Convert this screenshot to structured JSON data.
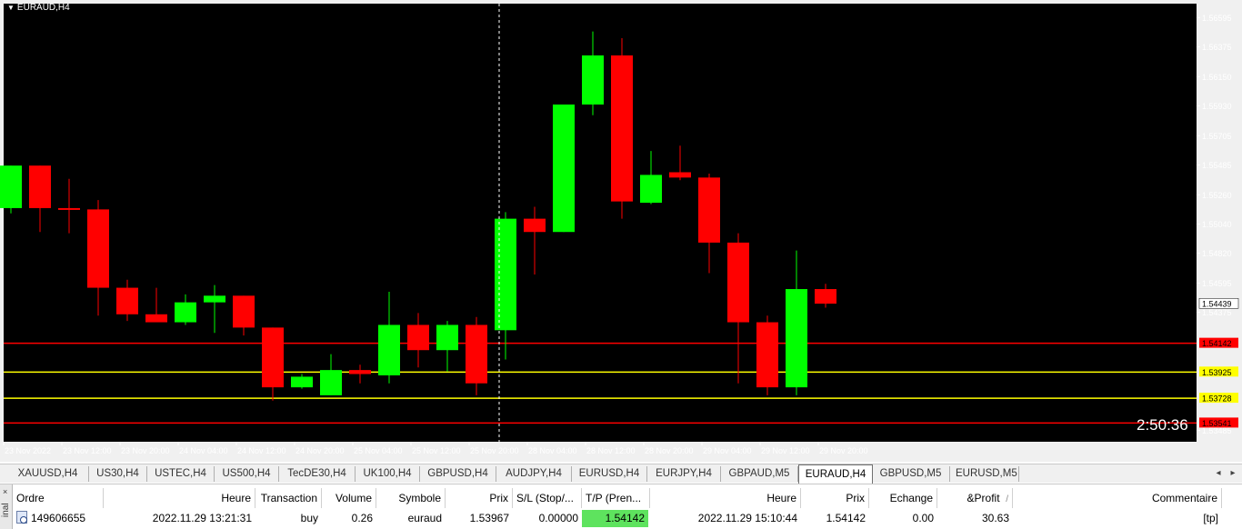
{
  "chart": {
    "title": "EURAUD,H4",
    "countdown": "2:50:36",
    "colors": {
      "bg": "#000000",
      "bull": "#00ff00",
      "bear": "#ff0000",
      "axis_text": "#ffffff",
      "crosshair": "#ffffff",
      "grid_bg": "#f0f0f0"
    },
    "price_labels": [
      "1.56595",
      "1.56375",
      "1.56150",
      "1.55930",
      "1.55705",
      "1.55485",
      "1.55260",
      "1.55040",
      "1.54820",
      "1.54595",
      "1.54375",
      "1.53485"
    ],
    "time_labels": [
      "23 Nov 2022",
      "23 Nov 12:00",
      "23 Nov 20:00",
      "24 Nov 04:00",
      "24 Nov 12:00",
      "24 Nov 20:00",
      "25 Nov 04:00",
      "25 Nov 12:00",
      "25 Nov 20:00",
      "28 Nov 04:00",
      "28 Nov 12:00",
      "28 Nov 20:00",
      "29 Nov 04:00",
      "29 Nov 12:00",
      "29 Nov 20:00"
    ],
    "current_price": {
      "label": "1.54439",
      "value": 1.54439
    },
    "levels": [
      {
        "label": "1.54142",
        "value": 1.54142,
        "color": "#ff0000",
        "text_color": "#000000"
      },
      {
        "label": "1.53925",
        "value": 1.53925,
        "color": "#ffff00",
        "text_color": "#000000"
      },
      {
        "label": "1.53728",
        "value": 1.53728,
        "color": "#ffff00",
        "text_color": "#000000"
      },
      {
        "label": "1.53541",
        "value": 1.53541,
        "color": "#ff0000",
        "text_color": "#000000"
      }
    ]
  },
  "chart_data": {
    "type": "candlestick",
    "title": "EURAUD,H4",
    "ylim": [
      1.534,
      1.567
    ],
    "candles": [
      {
        "o": 1.5516,
        "h": 1.5548,
        "l": 1.5512,
        "c": 1.5548
      },
      {
        "o": 1.5548,
        "h": 1.5548,
        "l": 1.5498,
        "c": 1.5516
      },
      {
        "o": 1.5516,
        "h": 1.5538,
        "l": 1.5497,
        "c": 1.5515
      },
      {
        "o": 1.5515,
        "h": 1.5522,
        "l": 1.5435,
        "c": 1.5456
      },
      {
        "o": 1.5456,
        "h": 1.5462,
        "l": 1.5431,
        "c": 1.5436
      },
      {
        "o": 1.5436,
        "h": 1.5456,
        "l": 1.543,
        "c": 1.543
      },
      {
        "o": 1.543,
        "h": 1.5451,
        "l": 1.5428,
        "c": 1.5445
      },
      {
        "o": 1.5445,
        "h": 1.5458,
        "l": 1.5422,
        "c": 1.545
      },
      {
        "o": 1.545,
        "h": 1.545,
        "l": 1.542,
        "c": 1.5426
      },
      {
        "o": 1.5426,
        "h": 1.5426,
        "l": 1.5371,
        "c": 1.5381
      },
      {
        "o": 1.5381,
        "h": 1.5391,
        "l": 1.538,
        "c": 1.5389
      },
      {
        "o": 1.5375,
        "h": 1.5406,
        "l": 1.5375,
        "c": 1.5394
      },
      {
        "o": 1.5394,
        "h": 1.5398,
        "l": 1.5384,
        "c": 1.5391
      },
      {
        "o": 1.539,
        "h": 1.5453,
        "l": 1.5384,
        "c": 1.5428
      },
      {
        "o": 1.5428,
        "h": 1.5437,
        "l": 1.5396,
        "c": 1.5409
      },
      {
        "o": 1.5409,
        "h": 1.5431,
        "l": 1.5393,
        "c": 1.5428
      },
      {
        "o": 1.5428,
        "h": 1.5434,
        "l": 1.5375,
        "c": 1.5384
      },
      {
        "o": 1.5424,
        "h": 1.5513,
        "l": 1.5402,
        "c": 1.5508
      },
      {
        "o": 1.5508,
        "h": 1.5517,
        "l": 1.5466,
        "c": 1.5498
      },
      {
        "o": 1.5498,
        "h": 1.5594,
        "l": 1.5498,
        "c": 1.5594
      },
      {
        "o": 1.5594,
        "h": 1.5649,
        "l": 1.5586,
        "c": 1.5631
      },
      {
        "o": 1.5631,
        "h": 1.5644,
        "l": 1.5508,
        "c": 1.5521
      },
      {
        "o": 1.552,
        "h": 1.5559,
        "l": 1.5519,
        "c": 1.5541
      },
      {
        "o": 1.5543,
        "h": 1.5563,
        "l": 1.5537,
        "c": 1.5539
      },
      {
        "o": 1.5539,
        "h": 1.5542,
        "l": 1.5467,
        "c": 1.549
      },
      {
        "o": 1.549,
        "h": 1.5497,
        "l": 1.5384,
        "c": 1.543
      },
      {
        "o": 1.543,
        "h": 1.5435,
        "l": 1.5375,
        "c": 1.5381
      },
      {
        "o": 1.5381,
        "h": 1.5484,
        "l": 1.5375,
        "c": 1.5455
      },
      {
        "o": 1.5455,
        "h": 1.5459,
        "l": 1.5441,
        "c": 1.5444
      }
    ]
  },
  "tabs": [
    "XAUUSD,H4",
    "US30,H4",
    "USTEC,H4",
    "US500,H4",
    "TecDE30,H4",
    "UK100,H4",
    "GBPUSD,H4",
    "AUDJPY,H4",
    "EURUSD,H4",
    "EURJPY,H4",
    "GBPAUD,M5",
    "EURAUD,H4",
    "GBPUSD,M5",
    "EURUSD,M5"
  ],
  "active_tab": "EURAUD,H4",
  "tab_scroll": {
    "left": "◂",
    "right": "▸"
  },
  "terminal": {
    "side_close": "×",
    "side_label": "inal",
    "headers": {
      "ordre": "Ordre",
      "heure": "Heure",
      "transaction": "Transaction",
      "volume": "Volume",
      "symbole": "Symbole",
      "prix": "Prix",
      "sl": "S/L (Stop/...",
      "tp": "T/P (Pren...",
      "heure2": "Heure",
      "prix2": "Prix",
      "echange": "Echange",
      "profit": "&Profit",
      "profit_sort": "/",
      "commentaire": "Commentaire"
    },
    "row": {
      "ordre": "149606655",
      "heure": "2022.11.29 13:21:31",
      "transaction": "buy",
      "volume": "0.26",
      "symbole": "euraud",
      "prix": "1.53967",
      "sl": "0.00000",
      "tp": "1.54142",
      "heure2": "2022.11.29 15:10:44",
      "prix2": "1.54142",
      "echange": "0.00",
      "profit": "30.63",
      "commentaire": "[tp]"
    }
  }
}
